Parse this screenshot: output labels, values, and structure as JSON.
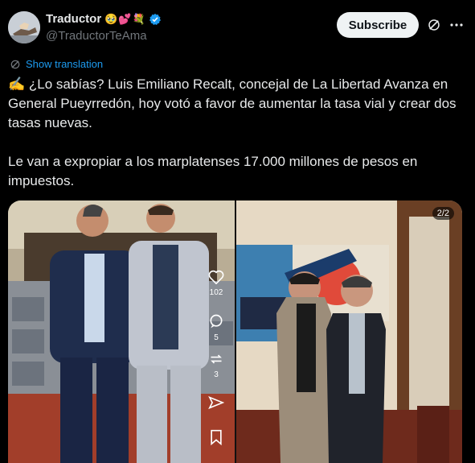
{
  "author": {
    "display_name": "Traductor",
    "emojis": [
      "🥹",
      "💕",
      "💐"
    ],
    "handle": "@TraductorTeAma",
    "avatar_icon": "avatar-hand-icon"
  },
  "header": {
    "subscribe_label": "Subscribe",
    "grok_icon": "grok-icon",
    "more_icon": "more-icon"
  },
  "translation": {
    "label": "Show translation"
  },
  "tweet": {
    "paragraph1": "✍️ ¿Lo sabías? Luis Emiliano Recalt, concejal de La Libertad Avanza en General Pueyrredón, hoy votó a favor de aumentar la tasa vial y crear dos tasas nuevas.",
    "paragraph2": "Le van a expropiar a los marplatenses 17.000 millones de pesos en impuestos."
  },
  "media": {
    "counter": "2/2",
    "likes": "102",
    "comments": "5",
    "reposts": "3"
  },
  "colors": {
    "accent": "#1d9bf0",
    "verified": "#1d9bf0",
    "background": "#000000"
  }
}
